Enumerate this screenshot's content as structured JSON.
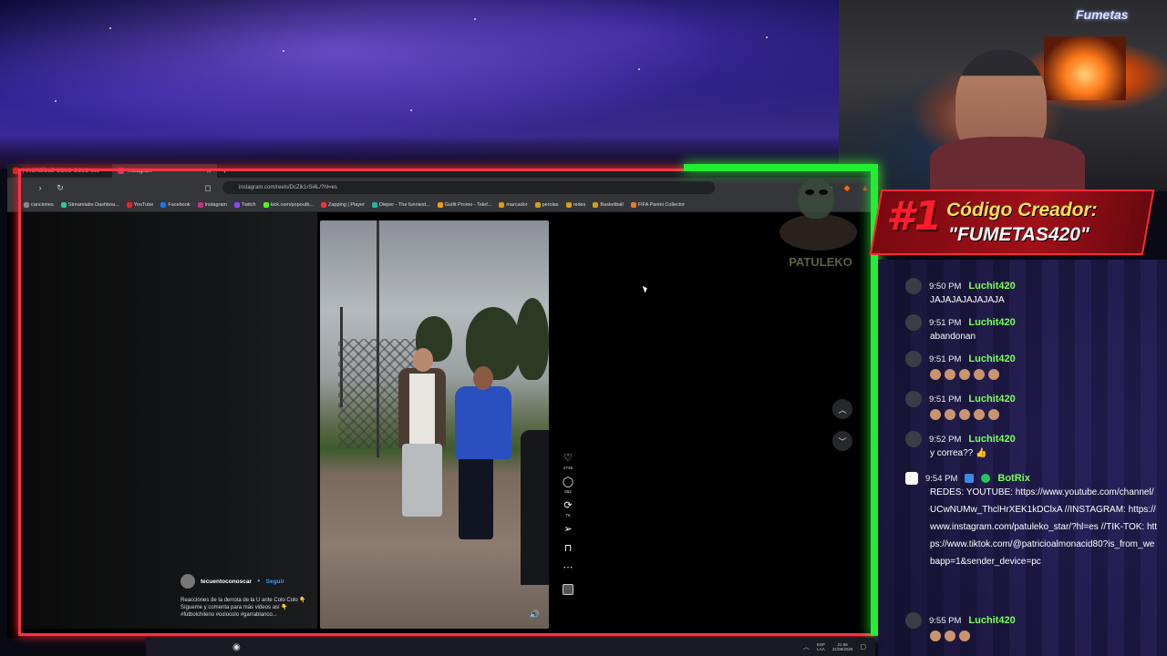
{
  "browser": {
    "tabs": [
      {
        "label": "| INCREÍBLE COLO-COLO sub",
        "active": false
      },
      {
        "label": "Instagram",
        "active": true
      }
    ],
    "new_tab": "+",
    "address": "instagram.com/reels/DcZik1rSi4L/?hl=es",
    "bookmarks": [
      "canciones",
      "Streamlabs Dashboa...",
      "YouTube",
      "Facebook",
      "Instagram",
      "Twitch",
      "kick.com/popoutb...",
      "Zapping | Player",
      "Dieper - The funniest...",
      "Gutlit Promo - Telef...",
      "marcador",
      "perolas",
      "redes",
      "Basketball",
      "FIFA Panini Collector"
    ]
  },
  "reel": {
    "username": "tecuentoconoscar",
    "follow": "Seguir",
    "caption": "Reacciones de la derrota de la U ante Colo Colo 👇 Sígueme y comenta para más videos así 👇 #futbolchileno #colocolo #garrablanco...",
    "likes": "2746",
    "comments": "564",
    "reposts": "76"
  },
  "taskbar": {
    "lang": "ESP\nLAA",
    "time": "21:56",
    "date": "21/08/2026"
  },
  "overlay": {
    "cam_logo": "Fumetas",
    "alien_text": "PATULEKO",
    "code_rank": "#1",
    "code_title": "Código Creador:",
    "code_value": "\"FUMETAS420\""
  },
  "chat": [
    {
      "time": "9:50 PM",
      "user": "Luchit420",
      "text": "JAJAJAJAJAJAJA"
    },
    {
      "time": "9:51 PM",
      "user": "Luchit420",
      "text": "abandonan"
    },
    {
      "time": "9:51 PM",
      "user": "Luchit420",
      "emotes": 5
    },
    {
      "time": "9:51 PM",
      "user": "Luchit420",
      "emotes": 5
    },
    {
      "time": "9:52 PM",
      "user": "Luchit420",
      "text": "y correa?? 👍"
    },
    {
      "time": "9:54 PM",
      "user": "BotRix",
      "bot": true,
      "text": "REDES: YOUTUBE: https://www.youtube.com/channel/UCwNUMw_ThclHrXEK1kDClxA //INSTAGRAM: https://www.instagram.com/patuleko_star/?hl=es //TIK-TOK: https://www.tiktok.com/@patricioalmonacid80?is_from_webapp=1&sender_device=pc"
    },
    {
      "time": "9:55 PM",
      "user": "Luchit420",
      "emotes": 3
    }
  ]
}
